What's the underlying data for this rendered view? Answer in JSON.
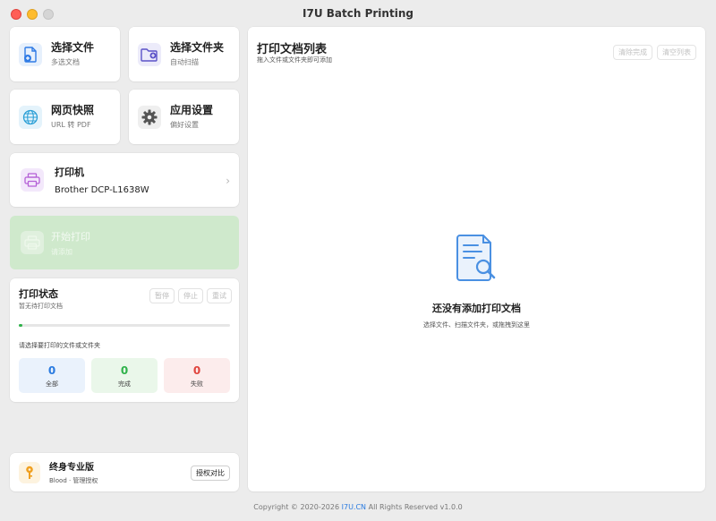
{
  "window": {
    "title": "I7U Batch Printing"
  },
  "tiles": [
    {
      "title": "选择文件",
      "subtitle": "多选文档",
      "icon": "add-file-icon",
      "color": "#2f7be5"
    },
    {
      "title": "选择文件夹",
      "subtitle": "自动扫描",
      "icon": "add-folder-icon",
      "color": "#5b52c8"
    },
    {
      "title": "网页快照",
      "subtitle": "URL 转 PDF",
      "icon": "globe-icon",
      "color": "#2a9fd6"
    },
    {
      "title": "应用设置",
      "subtitle": "偏好设置",
      "icon": "gear-icon",
      "color": "#555555"
    }
  ],
  "printer": {
    "title": "打印机",
    "name": "Brother DCP-L1638W"
  },
  "start": {
    "title": "开始打印",
    "subtitle": "请添加",
    "color": "#cfe9cc"
  },
  "status": {
    "title": "打印状态",
    "subtitle": "暂无待打印文档",
    "buttons": [
      "暂停",
      "停止",
      "重试"
    ],
    "progress": 0,
    "hint": "请选择要打印的文件或文件夹",
    "stats": [
      {
        "value": "0",
        "label": "全部",
        "color": "#2a7be0",
        "bg": "#eaf2fc"
      },
      {
        "value": "0",
        "label": "完成",
        "color": "#2fb24a",
        "bg": "#eaf7ea"
      },
      {
        "value": "0",
        "label": "失败",
        "color": "#e0443e",
        "bg": "#fcecec"
      }
    ]
  },
  "license": {
    "title": "终身专业版",
    "subtitle": "Blood · 管理授权",
    "button": "授权对比"
  },
  "list": {
    "title": "打印文档列表",
    "subtitle": "拖入文件或文件夹即可添加",
    "buttons": [
      "清除完成",
      "清空列表"
    ],
    "empty_title": "还没有添加打印文档",
    "empty_subtitle": "选择文件、扫描文件夹，或拖拽到这里"
  },
  "footer": {
    "copyright": "Copyright © 2020-2026",
    "link": "I7U.CN",
    "rights": "All Rights Reserved v1.0.0"
  }
}
